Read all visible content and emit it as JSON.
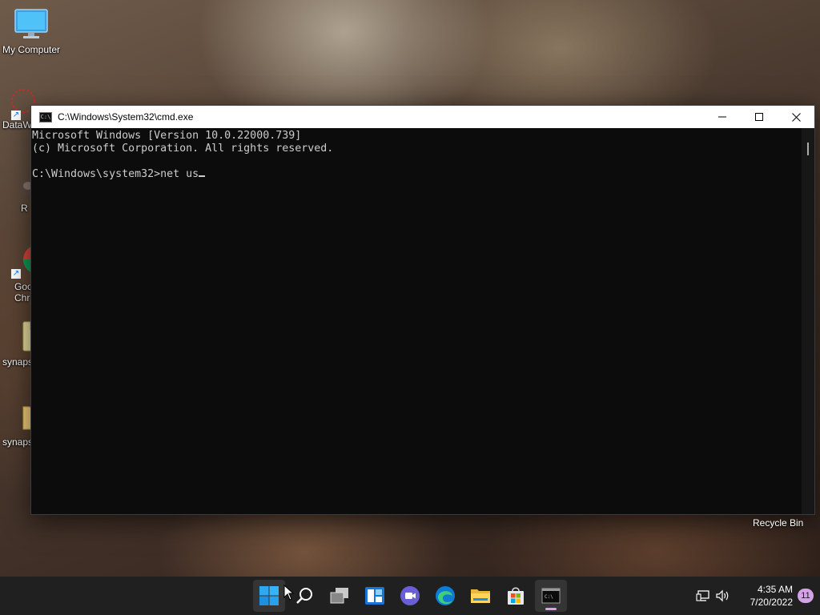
{
  "desktop": {
    "icons": [
      {
        "label": "My Computer"
      },
      {
        "label": "DataW"
      },
      {
        "label": "R"
      },
      {
        "label": "Goo\nChr"
      },
      {
        "label": "synaps"
      },
      {
        "label": "synaps"
      }
    ],
    "recycle_bin": "Recycle Bin"
  },
  "window": {
    "title": "C:\\Windows\\System32\\cmd.exe",
    "app_icon_text": "C:\\",
    "console_lines": [
      "Microsoft Windows [Version 10.0.22000.739]",
      "(c) Microsoft Corporation. All rights reserved.",
      "",
      "C:\\Windows\\system32>net us"
    ]
  },
  "taskbar": {
    "apps": [
      "start-icon",
      "search-icon",
      "task-view-icon",
      "widgets-icon",
      "chat-icon",
      "edge-icon",
      "file-explorer-icon",
      "store-icon",
      "terminal-icon"
    ],
    "clock_time": "4:35 AM",
    "clock_date": "7/20/2022",
    "notification_count": "11"
  },
  "colors": {
    "console_bg": "#0c0c0c",
    "console_fg": "#cccccc",
    "taskbar_bg": "#202020",
    "accent": "#e39ce5"
  }
}
